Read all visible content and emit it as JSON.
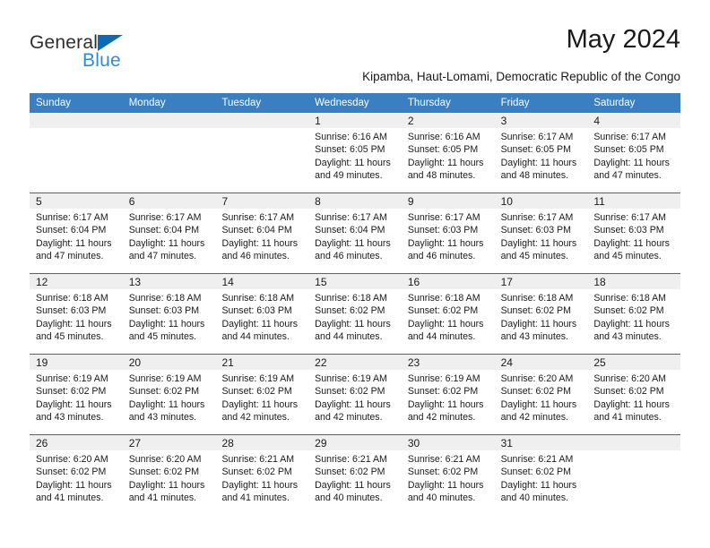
{
  "brand": {
    "name_top": "General",
    "name_bottom": "Blue",
    "triangle_icon": "triangle-icon",
    "accent_blue": "#2e8bdb",
    "logo_dark": "#2e2e2e",
    "triangle_color": "#0d6ab5"
  },
  "header": {
    "title": "May 2024",
    "subtitle": "Kipamba, Haut-Lomami, Democratic Republic of the Congo"
  },
  "theme": {
    "header_bar": "#3a7fc1",
    "week_rule": "#2e6da8",
    "day_band": "#efefef",
    "text": "#1a1a1a"
  },
  "weekdays": [
    "Sunday",
    "Monday",
    "Tuesday",
    "Wednesday",
    "Thursday",
    "Friday",
    "Saturday"
  ],
  "weeks": [
    [
      {
        "empty": true
      },
      {
        "empty": true
      },
      {
        "empty": true
      },
      {
        "day": "1",
        "sunrise": "Sunrise: 6:16 AM",
        "sunset": "Sunset: 6:05 PM",
        "daylight1": "Daylight: 11 hours",
        "daylight2": "and 49 minutes."
      },
      {
        "day": "2",
        "sunrise": "Sunrise: 6:16 AM",
        "sunset": "Sunset: 6:05 PM",
        "daylight1": "Daylight: 11 hours",
        "daylight2": "and 48 minutes."
      },
      {
        "day": "3",
        "sunrise": "Sunrise: 6:17 AM",
        "sunset": "Sunset: 6:05 PM",
        "daylight1": "Daylight: 11 hours",
        "daylight2": "and 48 minutes."
      },
      {
        "day": "4",
        "sunrise": "Sunrise: 6:17 AM",
        "sunset": "Sunset: 6:05 PM",
        "daylight1": "Daylight: 11 hours",
        "daylight2": "and 47 minutes."
      }
    ],
    [
      {
        "day": "5",
        "sunrise": "Sunrise: 6:17 AM",
        "sunset": "Sunset: 6:04 PM",
        "daylight1": "Daylight: 11 hours",
        "daylight2": "and 47 minutes."
      },
      {
        "day": "6",
        "sunrise": "Sunrise: 6:17 AM",
        "sunset": "Sunset: 6:04 PM",
        "daylight1": "Daylight: 11 hours",
        "daylight2": "and 47 minutes."
      },
      {
        "day": "7",
        "sunrise": "Sunrise: 6:17 AM",
        "sunset": "Sunset: 6:04 PM",
        "daylight1": "Daylight: 11 hours",
        "daylight2": "and 46 minutes."
      },
      {
        "day": "8",
        "sunrise": "Sunrise: 6:17 AM",
        "sunset": "Sunset: 6:04 PM",
        "daylight1": "Daylight: 11 hours",
        "daylight2": "and 46 minutes."
      },
      {
        "day": "9",
        "sunrise": "Sunrise: 6:17 AM",
        "sunset": "Sunset: 6:03 PM",
        "daylight1": "Daylight: 11 hours",
        "daylight2": "and 46 minutes."
      },
      {
        "day": "10",
        "sunrise": "Sunrise: 6:17 AM",
        "sunset": "Sunset: 6:03 PM",
        "daylight1": "Daylight: 11 hours",
        "daylight2": "and 45 minutes."
      },
      {
        "day": "11",
        "sunrise": "Sunrise: 6:17 AM",
        "sunset": "Sunset: 6:03 PM",
        "daylight1": "Daylight: 11 hours",
        "daylight2": "and 45 minutes."
      }
    ],
    [
      {
        "day": "12",
        "sunrise": "Sunrise: 6:18 AM",
        "sunset": "Sunset: 6:03 PM",
        "daylight1": "Daylight: 11 hours",
        "daylight2": "and 45 minutes."
      },
      {
        "day": "13",
        "sunrise": "Sunrise: 6:18 AM",
        "sunset": "Sunset: 6:03 PM",
        "daylight1": "Daylight: 11 hours",
        "daylight2": "and 45 minutes."
      },
      {
        "day": "14",
        "sunrise": "Sunrise: 6:18 AM",
        "sunset": "Sunset: 6:03 PM",
        "daylight1": "Daylight: 11 hours",
        "daylight2": "and 44 minutes."
      },
      {
        "day": "15",
        "sunrise": "Sunrise: 6:18 AM",
        "sunset": "Sunset: 6:02 PM",
        "daylight1": "Daylight: 11 hours",
        "daylight2": "and 44 minutes."
      },
      {
        "day": "16",
        "sunrise": "Sunrise: 6:18 AM",
        "sunset": "Sunset: 6:02 PM",
        "daylight1": "Daylight: 11 hours",
        "daylight2": "and 44 minutes."
      },
      {
        "day": "17",
        "sunrise": "Sunrise: 6:18 AM",
        "sunset": "Sunset: 6:02 PM",
        "daylight1": "Daylight: 11 hours",
        "daylight2": "and 43 minutes."
      },
      {
        "day": "18",
        "sunrise": "Sunrise: 6:18 AM",
        "sunset": "Sunset: 6:02 PM",
        "daylight1": "Daylight: 11 hours",
        "daylight2": "and 43 minutes."
      }
    ],
    [
      {
        "day": "19",
        "sunrise": "Sunrise: 6:19 AM",
        "sunset": "Sunset: 6:02 PM",
        "daylight1": "Daylight: 11 hours",
        "daylight2": "and 43 minutes."
      },
      {
        "day": "20",
        "sunrise": "Sunrise: 6:19 AM",
        "sunset": "Sunset: 6:02 PM",
        "daylight1": "Daylight: 11 hours",
        "daylight2": "and 43 minutes."
      },
      {
        "day": "21",
        "sunrise": "Sunrise: 6:19 AM",
        "sunset": "Sunset: 6:02 PM",
        "daylight1": "Daylight: 11 hours",
        "daylight2": "and 42 minutes."
      },
      {
        "day": "22",
        "sunrise": "Sunrise: 6:19 AM",
        "sunset": "Sunset: 6:02 PM",
        "daylight1": "Daylight: 11 hours",
        "daylight2": "and 42 minutes."
      },
      {
        "day": "23",
        "sunrise": "Sunrise: 6:19 AM",
        "sunset": "Sunset: 6:02 PM",
        "daylight1": "Daylight: 11 hours",
        "daylight2": "and 42 minutes."
      },
      {
        "day": "24",
        "sunrise": "Sunrise: 6:20 AM",
        "sunset": "Sunset: 6:02 PM",
        "daylight1": "Daylight: 11 hours",
        "daylight2": "and 42 minutes."
      },
      {
        "day": "25",
        "sunrise": "Sunrise: 6:20 AM",
        "sunset": "Sunset: 6:02 PM",
        "daylight1": "Daylight: 11 hours",
        "daylight2": "and 41 minutes."
      }
    ],
    [
      {
        "day": "26",
        "sunrise": "Sunrise: 6:20 AM",
        "sunset": "Sunset: 6:02 PM",
        "daylight1": "Daylight: 11 hours",
        "daylight2": "and 41 minutes."
      },
      {
        "day": "27",
        "sunrise": "Sunrise: 6:20 AM",
        "sunset": "Sunset: 6:02 PM",
        "daylight1": "Daylight: 11 hours",
        "daylight2": "and 41 minutes."
      },
      {
        "day": "28",
        "sunrise": "Sunrise: 6:21 AM",
        "sunset": "Sunset: 6:02 PM",
        "daylight1": "Daylight: 11 hours",
        "daylight2": "and 41 minutes."
      },
      {
        "day": "29",
        "sunrise": "Sunrise: 6:21 AM",
        "sunset": "Sunset: 6:02 PM",
        "daylight1": "Daylight: 11 hours",
        "daylight2": "and 40 minutes."
      },
      {
        "day": "30",
        "sunrise": "Sunrise: 6:21 AM",
        "sunset": "Sunset: 6:02 PM",
        "daylight1": "Daylight: 11 hours",
        "daylight2": "and 40 minutes."
      },
      {
        "day": "31",
        "sunrise": "Sunrise: 6:21 AM",
        "sunset": "Sunset: 6:02 PM",
        "daylight1": "Daylight: 11 hours",
        "daylight2": "and 40 minutes."
      },
      {
        "empty": true
      }
    ]
  ]
}
